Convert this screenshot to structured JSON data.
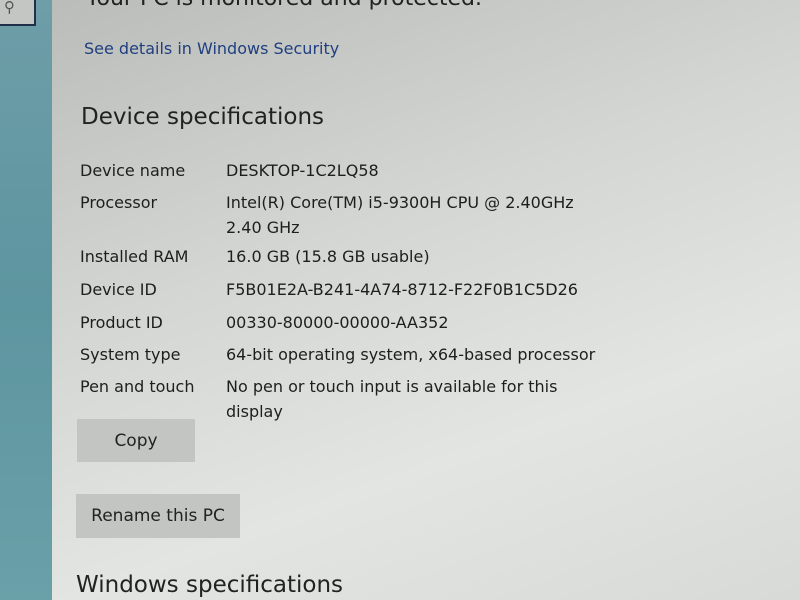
{
  "security": {
    "status": "Your PC is monitored and protected.",
    "link": "See details in Windows Security"
  },
  "device_specs": {
    "title": "Device specifications",
    "rows": [
      {
        "label": "Device name",
        "value": "DESKTOP-1C2LQ58"
      },
      {
        "label": "Processor",
        "value": "Intel(R) Core(TM) i5-9300H CPU @ 2.40GHz   2.40 GHz"
      },
      {
        "label": "Installed RAM",
        "value": "16.0 GB (15.8 GB usable)"
      },
      {
        "label": "Device ID",
        "value": "F5B01E2A-B241-4A74-8712-F22F0B1C5D26"
      },
      {
        "label": "Product ID",
        "value": "00330-80000-00000-AA352"
      },
      {
        "label": "System type",
        "value": "64-bit operating system, x64-based processor"
      },
      {
        "label": "Pen and touch",
        "value": "No pen or touch input is available for this display"
      }
    ],
    "copy_label": "Copy",
    "rename_label": "Rename this PC"
  },
  "windows_specs": {
    "title": "Windows specifications"
  },
  "icons": {
    "search": "search-icon"
  }
}
